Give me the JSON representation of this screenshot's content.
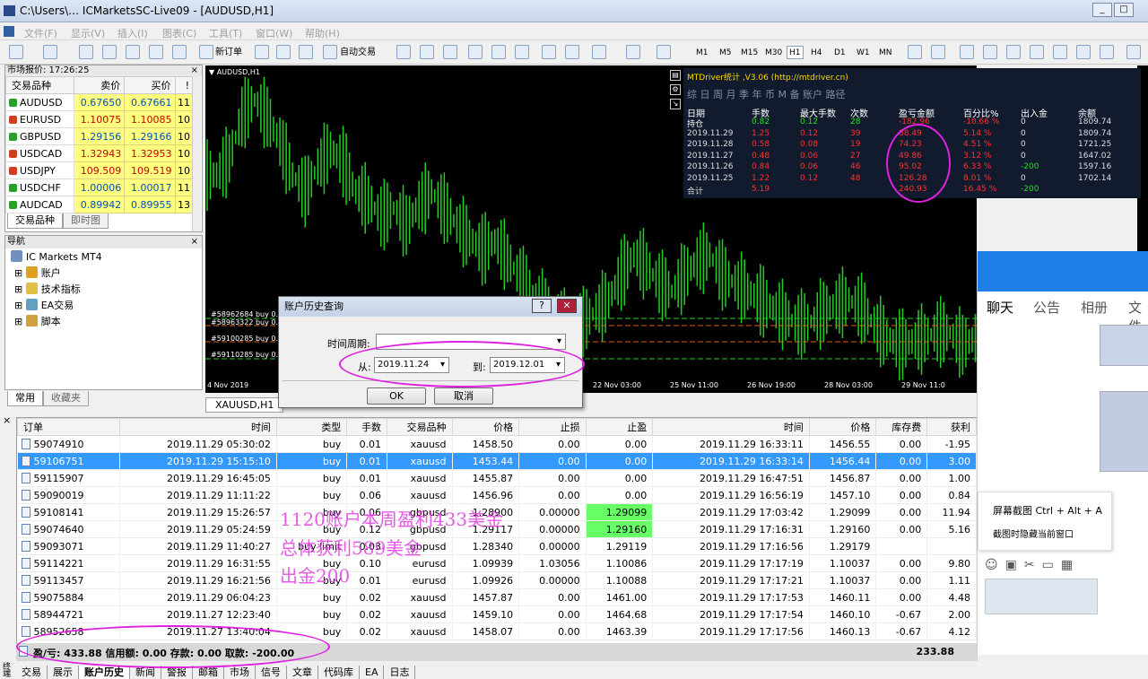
{
  "window": {
    "title": "C:\\Users\\… ICMarketsSC-Live09 - [AUDUSD,H1]"
  },
  "menu": [
    "文件(F)",
    "显示(V)",
    "插入(I)",
    "图表(C)",
    "工具(T)",
    "窗口(W)",
    "帮助(H)"
  ],
  "toolbar": {
    "new_order": "新订单",
    "auto_trade": "自动交易",
    "timeframes": [
      "M1",
      "M5",
      "M15",
      "M30",
      "H1",
      "H4",
      "D1",
      "W1",
      "MN"
    ],
    "active_tf": "H1"
  },
  "market_watch": {
    "header": "市场报价: 17:26:25",
    "columns": [
      "交易品种",
      "卖价",
      "买价",
      "!"
    ],
    "rows": [
      {
        "symbol": "AUDUSD",
        "bid": "0.67650",
        "ask": "0.67661",
        "spread": "11",
        "dir": "up"
      },
      {
        "symbol": "EURUSD",
        "bid": "1.10075",
        "ask": "1.10085",
        "spread": "10",
        "dir": "down"
      },
      {
        "symbol": "GBPUSD",
        "bid": "1.29156",
        "ask": "1.29166",
        "spread": "10",
        "dir": "up"
      },
      {
        "symbol": "USDCAD",
        "bid": "1.32943",
        "ask": "1.32953",
        "spread": "10",
        "dir": "down"
      },
      {
        "symbol": "USDJPY",
        "bid": "109.509",
        "ask": "109.519",
        "spread": "10",
        "dir": "down"
      },
      {
        "symbol": "USDCHF",
        "bid": "1.00006",
        "ask": "1.00017",
        "spread": "11",
        "dir": "up"
      },
      {
        "symbol": "AUDCAD",
        "bid": "0.89942",
        "ask": "0.89955",
        "spread": "13",
        "dir": "up"
      }
    ],
    "tabs": [
      "交易品种",
      "即时图"
    ]
  },
  "navigator": {
    "header": "导航",
    "root": "IC Markets MT4",
    "items": [
      "账户",
      "技术指标",
      "EA交易",
      "脚本"
    ],
    "tabs": [
      "常用",
      "收藏夹"
    ]
  },
  "chart": {
    "symbol_label": "AUDUSD,H1",
    "tab_label": "XAUUSD,H1",
    "xaxis": [
      "4 Nov 2019",
      "6 Nov",
      "Nov 03:00",
      "19 Nov 11:00",
      "20 Nov 19:00",
      "22 Nov 03:00",
      "25 Nov 11:00",
      "26 Nov 19:00",
      "28 Nov 03:00",
      "29 Nov 11:0"
    ],
    "order_lines": [
      "#58962684 buy 0.0",
      "#58963322 buy 0.0",
      "#59100285 buy 0.0",
      "#59110285 buy 0.0"
    ],
    "ohlc_close": [
      0.686,
      0.687,
      0.6895,
      0.6905,
      0.6895,
      0.688,
      0.686,
      0.685,
      0.6865,
      0.6875,
      0.6868,
      0.685,
      0.6845,
      0.6835,
      0.684,
      0.683,
      0.6842,
      0.685,
      0.684,
      0.683,
      0.6822,
      0.6815,
      0.682,
      0.681,
      0.6798,
      0.679,
      0.678,
      0.6774,
      0.6768,
      0.6772,
      0.6778,
      0.6785,
      0.68,
      0.6812,
      0.6805,
      0.6795,
      0.679,
      0.68,
      0.6808,
      0.6812,
      0.68,
      0.6795,
      0.679,
      0.6785,
      0.678,
      0.6775,
      0.677,
      0.6772,
      0.6778,
      0.6782,
      0.6785,
      0.678,
      0.677,
      0.6762,
      0.6758,
      0.676,
      0.6762,
      0.6766,
      0.6765,
      0.6758,
      0.6762
    ]
  },
  "mtdriver": {
    "title": "MTDriver统计 ,V3.06 (http://mtdriver.cn)",
    "menu": "综 日 周 月 季 年 币 M 备 账户        路径",
    "columns": [
      "日期",
      "手数",
      "最大手数",
      "次数",
      "盈亏金额",
      "百分比%",
      "出入金",
      "余额"
    ],
    "rows": [
      [
        "持仓",
        "0.82",
        "0.12",
        "28",
        "-182.96",
        "-10.66 %",
        "0",
        "1809.74"
      ],
      [
        "2019.11.29",
        "1.25",
        "0.12",
        "39",
        "88.49",
        "5.14 %",
        "0",
        "1809.74"
      ],
      [
        "2019.11.28",
        "0.58",
        "0.08",
        "19",
        "74.23",
        "4.51 %",
        "0",
        "1721.25"
      ],
      [
        "2019.11.27",
        "0.48",
        "0.06",
        "27",
        "49.86",
        "3.12 %",
        "0",
        "1647.02"
      ],
      [
        "2019.11.26",
        "0.84",
        "0.06",
        "46",
        "95.02",
        "6.33 %",
        "-200",
        "1597.16"
      ],
      [
        "2019.11.25",
        "1.22",
        "0.12",
        "48",
        "126.28",
        "8.01 %",
        "0",
        "1702.14"
      ],
      [
        "合计",
        "5.19",
        "",
        "",
        "240.93",
        "16.45 %",
        "-200",
        ""
      ]
    ]
  },
  "dialog": {
    "title": "账户历史查询",
    "period_label": "时间周期:",
    "from_label": "从:",
    "from": "2019.11.24",
    "to_label": "到:",
    "to": "2019.12.01",
    "ok": "OK",
    "cancel": "取消"
  },
  "terminal": {
    "columns": [
      "订单",
      "时间",
      "类型",
      "手数",
      "交易品种",
      "价格",
      "止损",
      "止盈",
      "时间",
      "价格",
      "库存费",
      "获利"
    ],
    "rows": [
      [
        "59074910",
        "2019.11.29 05:30:02",
        "buy",
        "0.01",
        "xauusd",
        "1458.50",
        "0.00",
        "0.00",
        "2019.11.29 16:33:11",
        "1456.55",
        "0.00",
        "-1.95"
      ],
      [
        "59106751",
        "2019.11.29 15:15:10",
        "buy",
        "0.01",
        "xauusd",
        "1453.44",
        "0.00",
        "0.00",
        "2019.11.29 16:33:14",
        "1456.44",
        "0.00",
        "3.00"
      ],
      [
        "59115907",
        "2019.11.29 16:45:05",
        "buy",
        "0.01",
        "xauusd",
        "1455.87",
        "0.00",
        "0.00",
        "2019.11.29 16:47:51",
        "1456.87",
        "0.00",
        "1.00"
      ],
      [
        "59090019",
        "2019.11.29 11:11:22",
        "buy",
        "0.06",
        "xauusd",
        "1456.96",
        "0.00",
        "0.00",
        "2019.11.29 16:56:19",
        "1457.10",
        "0.00",
        "0.84"
      ],
      [
        "59108141",
        "2019.11.29 15:26:57",
        "buy",
        "0.06",
        "gbpusd",
        "1.28900",
        "0.00000",
        "1.29099",
        "2019.11.29 17:03:42",
        "1.29099",
        "0.00",
        "11.94"
      ],
      [
        "59074640",
        "2019.11.29 05:24:59",
        "buy",
        "0.12",
        "gbpusd",
        "1.29117",
        "0.00000",
        "1.29160",
        "2019.11.29 17:16:31",
        "1.29160",
        "0.00",
        "5.16"
      ],
      [
        "59093071",
        "2019.11.29 11:40:27",
        "buy limit",
        "0.03",
        "gbpusd",
        "1.28340",
        "0.00000",
        "1.29119",
        "2019.11.29 17:16:56",
        "1.29179",
        "",
        ""
      ],
      [
        "59114221",
        "2019.11.29 16:31:55",
        "buy",
        "0.10",
        "eurusd",
        "1.09939",
        "1.03056",
        "1.10086",
        "2019.11.29 17:17:19",
        "1.10037",
        "0.00",
        "9.80"
      ],
      [
        "59113457",
        "2019.11.29 16:21:56",
        "buy",
        "0.01",
        "eurusd",
        "1.09926",
        "0.00000",
        "1.10088",
        "2019.11.29 17:17:21",
        "1.10037",
        "0.00",
        "1.11"
      ],
      [
        "59075884",
        "2019.11.29 06:04:23",
        "buy",
        "0.02",
        "xauusd",
        "1457.87",
        "0.00",
        "1461.00",
        "2019.11.29 17:17:53",
        "1460.11",
        "0.00",
        "4.48"
      ],
      [
        "58944721",
        "2019.11.27 12:23:40",
        "buy",
        "0.02",
        "xauusd",
        "1459.10",
        "0.00",
        "1464.68",
        "2019.11.29 17:17:54",
        "1460.10",
        "-0.67",
        "2.00"
      ],
      [
        "58952658",
        "2019.11.27 13:40:04",
        "buy",
        "0.02",
        "xauusd",
        "1458.07",
        "0.00",
        "1463.39",
        "2019.11.29 17:17:56",
        "1460.13",
        "-0.67",
        "4.12"
      ]
    ],
    "summary": "盈/亏: 433.88  信用额: 0.00  存款: 0.00  取款: -200.00",
    "summary_total": "233.88",
    "tabs": [
      "交易",
      "展示",
      "账户历史",
      "新闻",
      "警报",
      "邮箱",
      "市场",
      "信号",
      "文章",
      "代码库",
      "EA",
      "日志"
    ]
  },
  "annotations": [
    "1120账户本周盈利433美金",
    "总体获利589美金",
    "出金200"
  ],
  "qq": {
    "tabs": [
      "聊天",
      "公告",
      "相册",
      "文件"
    ],
    "menu": [
      "屏幕截图 Ctrl + Alt + A",
      "截图时隐藏当前窗口"
    ]
  }
}
